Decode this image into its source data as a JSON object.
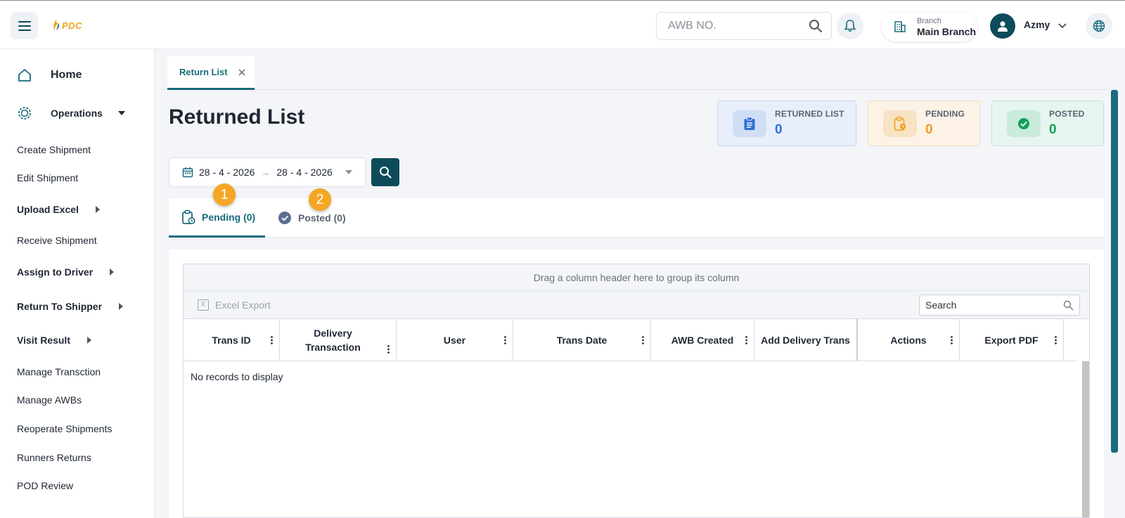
{
  "header": {
    "logo_text": "PDC",
    "awb_placeholder": "AWB NO.",
    "branch_caption": "Branch",
    "branch_name": "Main Branch",
    "user_name": "Azmy"
  },
  "sidebar": {
    "items": [
      {
        "label": "Home"
      },
      {
        "label": "Operations"
      },
      {
        "label": "Create Shipment"
      },
      {
        "label": "Edit Shipment"
      },
      {
        "label": "Upload Excel"
      },
      {
        "label": "Receive Shipment"
      },
      {
        "label": "Assign to Driver"
      },
      {
        "label": "Return To Shipper"
      },
      {
        "label": "Visit Result"
      },
      {
        "label": "Manage Transction"
      },
      {
        "label": "Manage AWBs"
      },
      {
        "label": "Reoperate Shipments"
      },
      {
        "label": "Runners Returns"
      },
      {
        "label": "POD Review"
      }
    ]
  },
  "doc_tab": {
    "label": "Return List"
  },
  "page": {
    "title": "Returned List"
  },
  "stats": {
    "returned": {
      "label": "RETURNED LIST",
      "value": "0",
      "color": "#2f6fd6"
    },
    "pending": {
      "label": "PENDING",
      "value": "0",
      "color": "#ef9f1c"
    },
    "posted": {
      "label": "POSTED",
      "value": "0",
      "color": "#15a05a"
    }
  },
  "date_range": {
    "from": "28 - 4 - 2026",
    "to": "28 - 4 - 2026",
    "separator": "→"
  },
  "status_tabs": {
    "pending": "Pending (0)",
    "posted": "Posted (0)"
  },
  "badges": {
    "one": "1",
    "two": "2"
  },
  "grid": {
    "group_hint": "Drag a column header here to group its column",
    "export_label": "Excel Export",
    "export_icon_text": "X",
    "search_placeholder": "Search",
    "columns": [
      {
        "label": "Trans ID"
      },
      {
        "label": "Delivery Transaction"
      },
      {
        "label": "User"
      },
      {
        "label": "Trans Date"
      },
      {
        "label": "AWB Created"
      },
      {
        "label": "Add Delivery Trans"
      },
      {
        "label": "Actions"
      },
      {
        "label": "Export PDF"
      }
    ],
    "empty_message": "No records to display"
  },
  "colors": {
    "primary": "#0e4b5a",
    "accent": "#1a6b7c",
    "badge": "#f5a623"
  }
}
